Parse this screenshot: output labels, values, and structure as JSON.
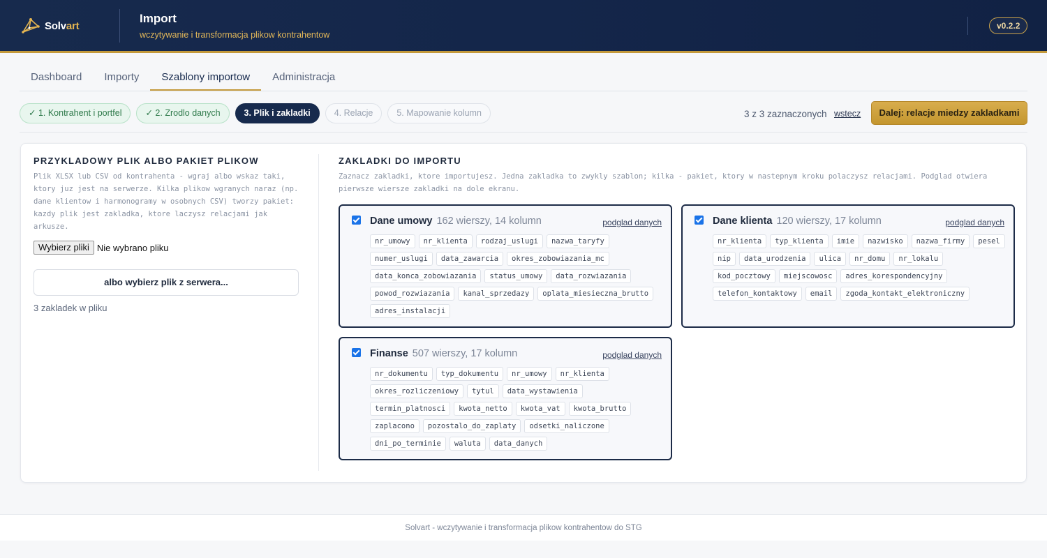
{
  "header": {
    "logo_text_1": "Solv",
    "logo_text_2": "art",
    "title": "Import",
    "subtitle": "wczytywanie i transformacja plikow kontrahentow",
    "version": "v0.2.2",
    "accent_color": "#c49a3c"
  },
  "tabs": [
    {
      "label": "Dashboard",
      "active": false
    },
    {
      "label": "Importy",
      "active": false
    },
    {
      "label": "Szablony importow",
      "active": true
    },
    {
      "label": "Administracja",
      "active": false
    }
  ],
  "steps": [
    {
      "label": "✓ 1. Kontrahent i portfel",
      "state": "done"
    },
    {
      "label": "✓ 2. Zrodlo danych",
      "state": "done"
    },
    {
      "label": "3. Plik i zakladki",
      "state": "current"
    },
    {
      "label": "4. Relacje",
      "state": "pending"
    },
    {
      "label": "5. Mapowanie kolumn",
      "state": "pending"
    }
  ],
  "toolbar": {
    "selection_count": "3 z 3 zaznaczonych",
    "back_label": "wstecz",
    "next_label": "Dalej: relacje miedzy zakladkami"
  },
  "left": {
    "title": "PRZYKLADOWY PLIK ALBO PAKIET PLIKOW",
    "description": "Plik XLSX lub CSV od kontrahenta - wgraj albo wskaz taki, ktory juz jest na serwerze. Kilka plikow wgranych naraz (np. dane klientow i harmonogramy w osobnych CSV) tworzy pakiet: kazdy plik jest zakladka, ktore laczysz relacjami jak arkusze.",
    "file_button": "Wybierz pliki",
    "file_status": "Nie wybrano pliku",
    "server_button": "albo wybierz plik z serwera...",
    "sheet_count": "3 zakladek w pliku"
  },
  "right": {
    "title": "ZAKLADKI DO IMPORTU",
    "description": "Zaznacz zakladki, ktore importujesz. Jedna zakladka to zwykly szablon; kilka - pakiet, ktory w nastepnym kroku polaczysz relacjami. Podglad otwiera pierwsze wiersze zakladki na dole ekranu.",
    "preview_label": "podglad danych",
    "sheets": [
      {
        "name": "Dane umowy",
        "meta": "162 wierszy, 14 kolumn",
        "checked": true,
        "columns": [
          "nr_umowy",
          "nr_klienta",
          "rodzaj_uslugi",
          "nazwa_taryfy",
          "numer_uslugi",
          "data_zawarcia",
          "okres_zobowiazania_mc",
          "data_konca_zobowiazania",
          "status_umowy",
          "data_rozwiazania",
          "powod_rozwiazania",
          "kanal_sprzedazy",
          "oplata_miesieczna_brutto",
          "adres_instalacji"
        ]
      },
      {
        "name": "Dane klienta",
        "meta": "120 wierszy, 17 kolumn",
        "checked": true,
        "columns": [
          "nr_klienta",
          "typ_klienta",
          "imie",
          "nazwisko",
          "nazwa_firmy",
          "pesel",
          "nip",
          "data_urodzenia",
          "ulica",
          "nr_domu",
          "nr_lokalu",
          "kod_pocztowy",
          "miejscowosc",
          "adres_korespondencyjny",
          "telefon_kontaktowy",
          "email",
          "zgoda_kontakt_elektroniczny"
        ]
      },
      {
        "name": "Finanse",
        "meta": "507 wierszy, 17 kolumn",
        "checked": true,
        "columns": [
          "nr_dokumentu",
          "typ_dokumentu",
          "nr_umowy",
          "nr_klienta",
          "okres_rozliczeniowy",
          "tytul",
          "data_wystawienia",
          "termin_platnosci",
          "kwota_netto",
          "kwota_vat",
          "kwota_brutto",
          "zaplacono",
          "pozostalo_do_zaplaty",
          "odsetki_naliczone",
          "dni_po_terminie",
          "waluta",
          "data_danych"
        ]
      }
    ]
  },
  "footer": {
    "text": "Solvart - wczytywanie i transformacja plikow kontrahentow do STG"
  }
}
